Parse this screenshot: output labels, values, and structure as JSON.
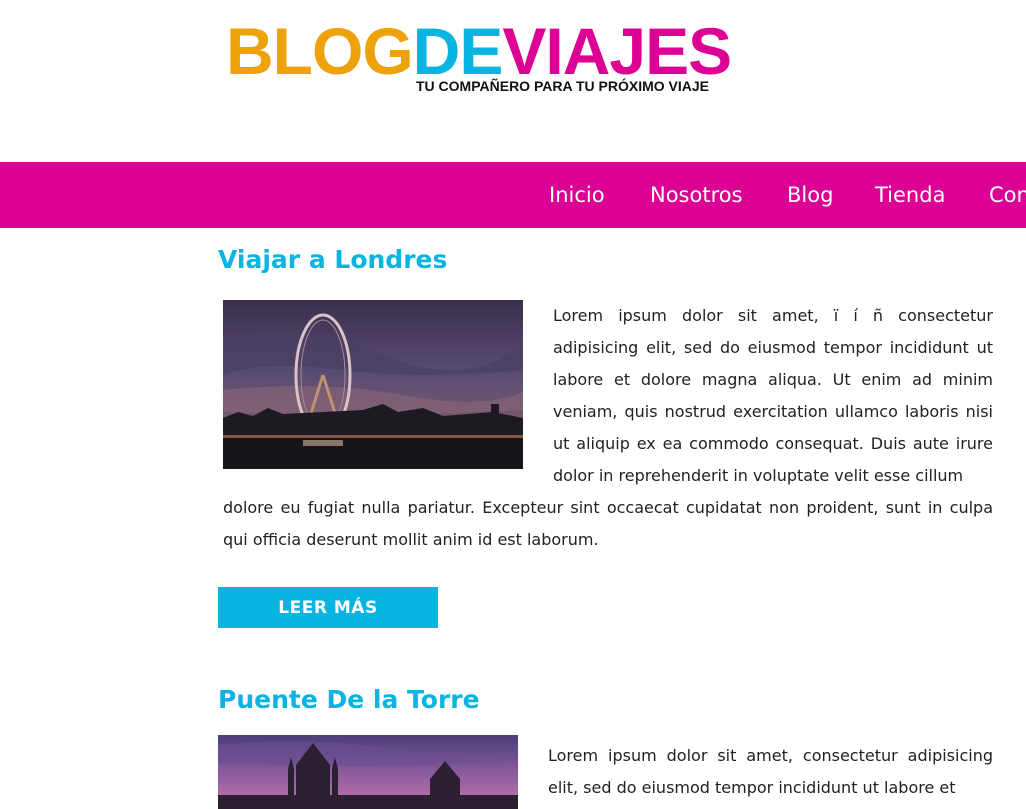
{
  "header": {
    "logo": {
      "part1": "BLOG",
      "part2": "DE",
      "part3": "VIAJES",
      "tagline": "TU COMPAÑERO PARA TU PRÓXIMO VIAJE",
      "colors": {
        "part1": "#eea20a",
        "part2": "#0ab4e0",
        "part3": "#dc0095"
      }
    }
  },
  "nav": {
    "background": "#dc0095",
    "items": [
      "Inicio",
      "Nosotros",
      "Blog",
      "Tienda",
      "Contacto"
    ]
  },
  "posts": [
    {
      "title": "Viajar a Londres",
      "image_alt": "london-eye-photo",
      "text_wrapped": "Lorem ipsum dolor sit amet, ï í ñ consectetur adipisicing elit, sed do eiusmod tempor incididunt ut labore et dolore magna aliqua. Ut enim ad minim veniam, quis nostrud exercitation ullamco laboris nisi ut aliquip ex ea commodo consequat. Duis aute irure dolor in reprehenderit in voluptate velit esse cillum",
      "text_full": "dolore eu fugiat nulla pariatur. Excepteur sint occaecat cupidatat non proident, sunt in culpa qui officia deserunt mollit anim id est laborum.",
      "button": "LEER MÁS"
    },
    {
      "title": "Puente De la Torre",
      "image_alt": "tower-bridge-photo",
      "text_wrapped": "Lorem ipsum dolor sit amet, consectetur adipisicing elit, sed do eiusmod tempor incididunt ut labore et"
    }
  ],
  "colors": {
    "accent": "#0ab4e0",
    "brand": "#dc0095",
    "logo_orange": "#eea20a"
  }
}
